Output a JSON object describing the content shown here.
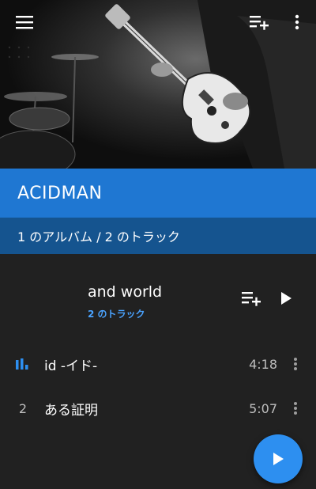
{
  "header": {
    "menu_icon": "hamburger-menu-icon",
    "add_queue_icon": "playlist-add-icon",
    "overflow_icon": "more-vertical-icon"
  },
  "artist": {
    "name": "ACIDMAN",
    "summary": "1 のアルバム / 2 のトラック"
  },
  "album": {
    "title": "and world",
    "track_count": "2 のトラック"
  },
  "tracks": [
    {
      "number": "",
      "playing": true,
      "title": "id -イド-",
      "duration": "4:18"
    },
    {
      "number": "2",
      "playing": false,
      "title": "ある証明",
      "duration": "5:07"
    }
  ],
  "colors": {
    "accent": "#1f77d2",
    "accent_dark": "#15548f",
    "background": "#212121",
    "link": "#4aa3ff",
    "fab": "#2d8ff0"
  }
}
